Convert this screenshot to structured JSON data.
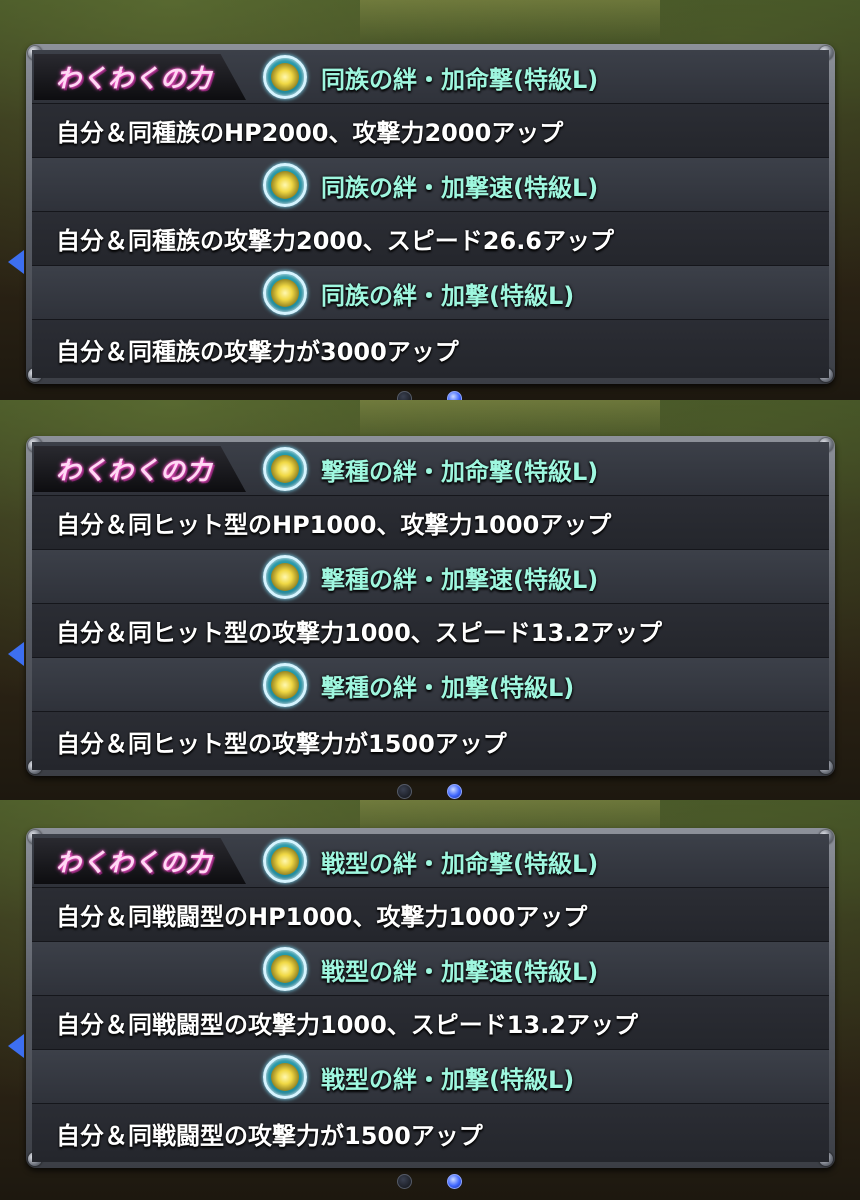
{
  "panels": [
    {
      "badge": "わくわくの力",
      "rows": [
        {
          "title": "同族の絆・加命撃(特級L)",
          "desc": "自分＆同種族のHP2000、攻撃力2000アップ"
        },
        {
          "title": "同族の絆・加撃速(特級L)",
          "desc": "自分＆同種族の攻撃力2000、スピード26.6アップ"
        },
        {
          "title": "同族の絆・加撃(特級L)",
          "desc": "自分＆同種族の攻撃力が3000アップ"
        }
      ],
      "page_indicator": {
        "pages": 2,
        "current": 2
      }
    },
    {
      "badge": "わくわくの力",
      "rows": [
        {
          "title": "撃種の絆・加命撃(特級L)",
          "desc": "自分＆同ヒット型のHP1000、攻撃力1000アップ"
        },
        {
          "title": "撃種の絆・加撃速(特級L)",
          "desc": "自分＆同ヒット型の攻撃力1000、スピード13.2アップ"
        },
        {
          "title": "撃種の絆・加撃(特級L)",
          "desc": "自分＆同ヒット型の攻撃力が1500アップ"
        }
      ],
      "page_indicator": {
        "pages": 2,
        "current": 2
      }
    },
    {
      "badge": "わくわくの力",
      "rows": [
        {
          "title": "戦型の絆・加命撃(特級L)",
          "desc": "自分＆同戦闘型のHP1000、攻撃力1000アップ"
        },
        {
          "title": "戦型の絆・加撃速(特級L)",
          "desc": "自分＆同戦闘型の攻撃力1000、スピード13.2アップ"
        },
        {
          "title": "戦型の絆・加撃(特級L)",
          "desc": "自分＆同戦闘型の攻撃力が1500アップ"
        }
      ],
      "page_indicator": {
        "pages": 2,
        "current": 2
      }
    }
  ],
  "colors": {
    "title_text": "#9ff7df",
    "desc_text": "#ffffff",
    "badge_text": "#ffd8f4",
    "active_dot": "#3e66ff",
    "nav_arrow": "#3d6ff0"
  },
  "icons": {
    "skill": "lightning-orb-icon",
    "nav": "left-arrow-icon"
  }
}
